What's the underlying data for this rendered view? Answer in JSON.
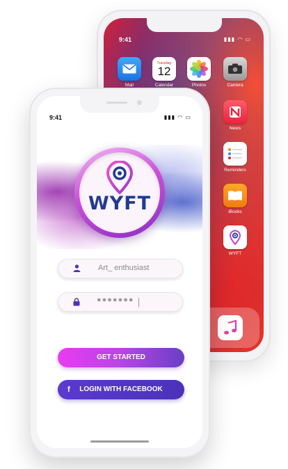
{
  "back_phone": {
    "status_time": "9:41",
    "apps": [
      {
        "label": "Mail",
        "icon": "mail-icon"
      },
      {
        "label": "Calendar",
        "icon": "calendar-icon",
        "day": "Tuesday",
        "date": "12"
      },
      {
        "label": "Photos",
        "icon": "photos-icon"
      },
      {
        "label": "Camera",
        "icon": "camera-icon"
      },
      {
        "label": "News",
        "icon": "news-icon"
      },
      {
        "label": "Reminders",
        "icon": "reminders-icon"
      },
      {
        "label": "iBooks",
        "icon": "ibooks-icon"
      },
      {
        "label": "WYFT",
        "icon": "wyft-app-icon"
      }
    ]
  },
  "front_phone": {
    "status_time": "9:41",
    "logo_text": "WYFT",
    "username_value": "Art_ enthusiast",
    "password_value": "●●●●●●●",
    "get_started_label": "GET STARTED",
    "facebook_label": "LOGIN WITH FACEBOOK",
    "colors": {
      "brand_blue": "#223a8f",
      "brand_pink": "#e93bf0",
      "brand_purple": "#6a3fc4",
      "facebook_purple": "#4b32b8"
    }
  }
}
